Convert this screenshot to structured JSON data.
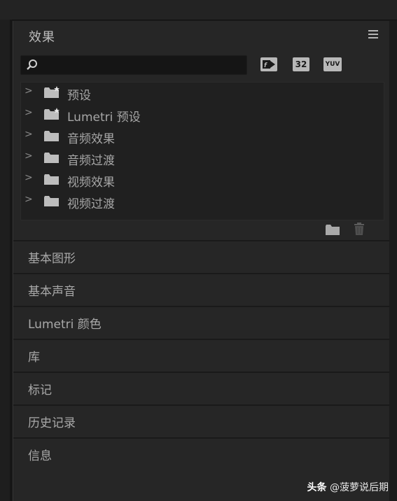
{
  "panel": {
    "title": "效果",
    "menu_icon": "hamburger-menu-icon"
  },
  "search": {
    "value": "",
    "placeholder": ""
  },
  "filters": {
    "accelerated_label": "",
    "bit32_label": "32",
    "yuv_label": "YUV"
  },
  "tree": {
    "items": [
      {
        "label": "预设",
        "icon": "preset-folder-icon"
      },
      {
        "label": "Lumetri 预设",
        "icon": "preset-folder-icon"
      },
      {
        "label": "音频效果",
        "icon": "folder-icon"
      },
      {
        "label": "音频过渡",
        "icon": "folder-icon"
      },
      {
        "label": "视频效果",
        "icon": "folder-icon"
      },
      {
        "label": "视频过渡",
        "icon": "folder-icon"
      }
    ]
  },
  "sections": [
    {
      "label": "基本图形"
    },
    {
      "label": "基本声音"
    },
    {
      "label": "Lumetri 颜色"
    },
    {
      "label": "库"
    },
    {
      "label": "标记"
    },
    {
      "label": "历史记录"
    },
    {
      "label": "信息"
    }
  ],
  "watermark": {
    "prefix": "头条",
    "handle": "@菠萝说后期"
  },
  "colors": {
    "panel_bg": "#262626",
    "text": "#a9a9a9",
    "button_bg": "#b8b8b8"
  }
}
